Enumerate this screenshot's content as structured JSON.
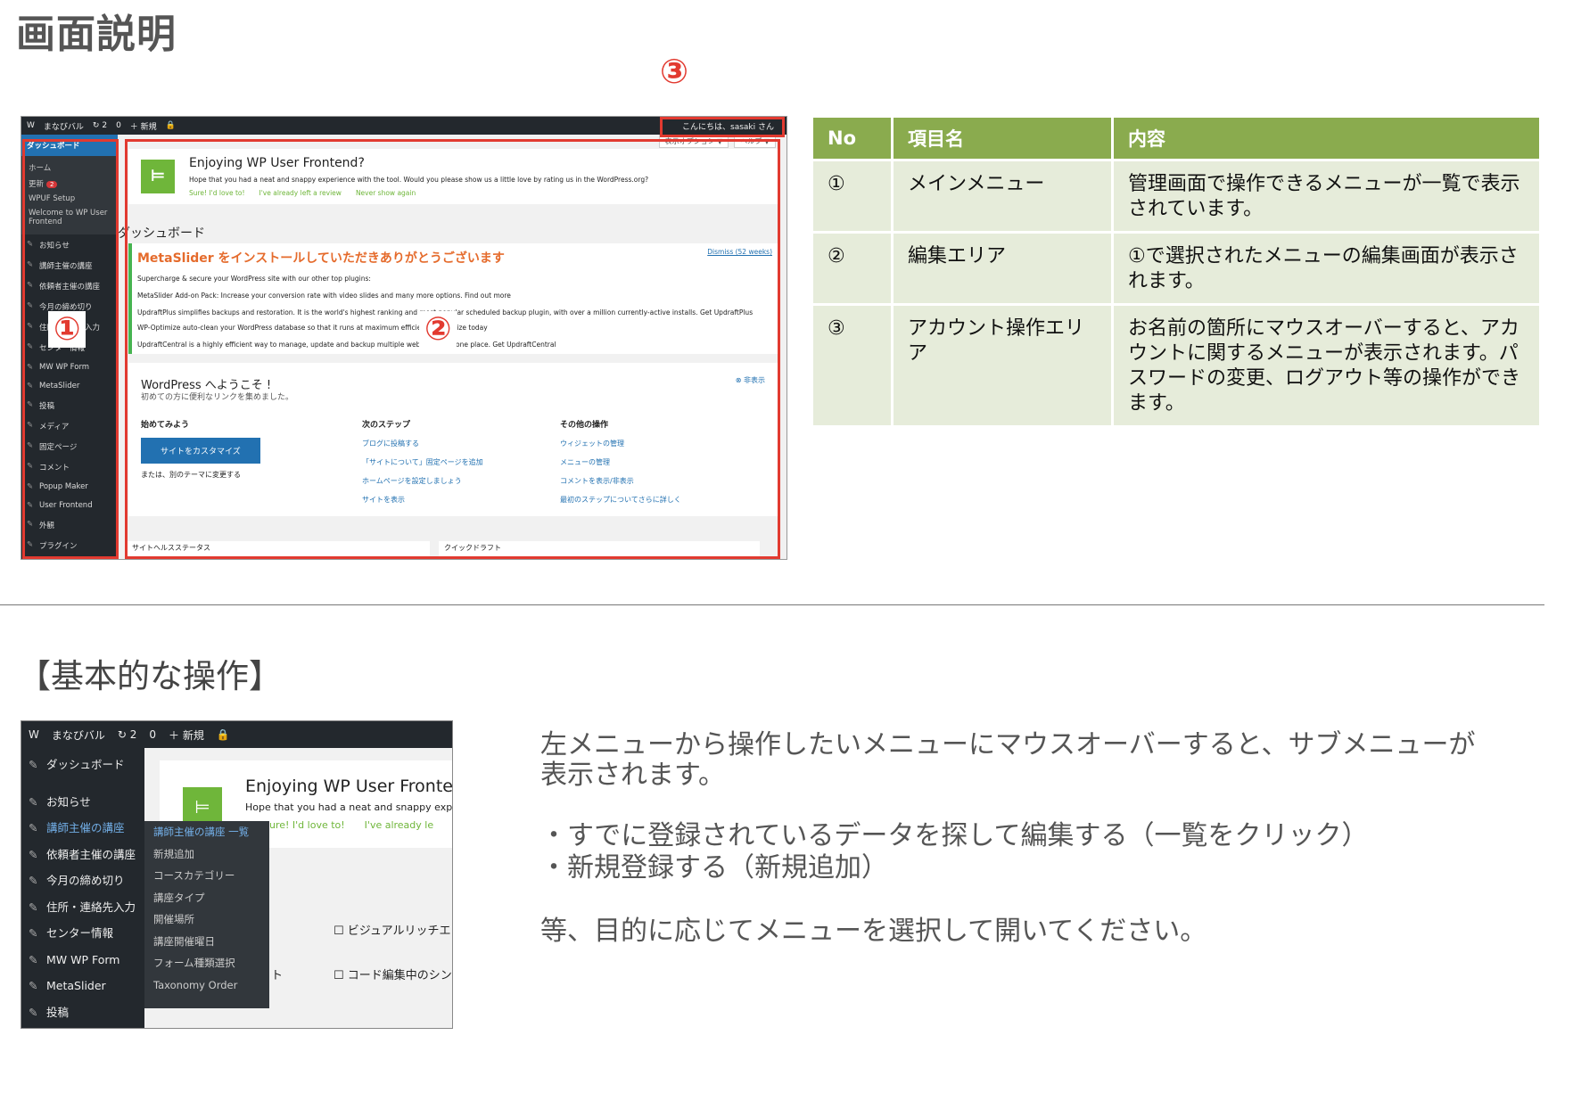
{
  "page_title": "画面説明",
  "marker3": "③",
  "shot1": {
    "topbar": [
      "W",
      "まなびバル",
      "↻ 2",
      "0",
      "＋ 新規",
      "🔒"
    ],
    "account": "こんにちは、sasaki さん",
    "side_dashboard": "ダッシュボード",
    "side_sub": [
      "ホーム",
      "更新",
      "WPUF Setup",
      "Welcome to WP User Frontend"
    ],
    "side_update_badge": "2",
    "side_items": [
      "お知らせ",
      "講師主催の講座",
      "依頼者主催の講座",
      "今月の締め切り",
      "住所・連絡先入力",
      "センター情報",
      "MW WP Form",
      "MetaSlider",
      "投稿",
      "メディア",
      "固定ページ",
      "コメント",
      "Popup Maker",
      "User Frontend",
      "外観",
      "プラグイン"
    ],
    "tabs": [
      "表示オプション ▼",
      "ヘルプ ▼"
    ],
    "wpuf_title": "Enjoying WP User Frontend?",
    "wpuf_text": "Hope that you had a neat and snappy experience with the tool. Would you please show us a little love by rating us in the WordPress.org?",
    "wpuf_links": [
      "Sure! I'd love to!",
      "I've already left a review",
      "Never show again"
    ],
    "dashboard_heading": "ダッシュボード",
    "ms_title": "MetaSlider をインストールしていただきありがとうございます",
    "ms_dismiss": "Dismiss (52 weeks)",
    "ms_lines": [
      "Supercharge & secure your WordPress site with our other top plugins:",
      "MetaSlider Add-on Pack: Increase your conversion rate with video slides and many more options. Find out more",
      "UpdraftPlus simplifies backups and restoration. It is the world's highest ranking and most popular scheduled backup plugin, with over a million currently-active installs. Get UpdraftPlus",
      "WP-Optimize auto-clean your WordPress database so that it runs at maximum efficiency. Optimize today",
      "UpdraftCentral is a highly efficient way to manage, update and backup multiple websites from one place. Get UpdraftCentral"
    ],
    "welcome_title": "WordPress へようこそ !",
    "welcome_sub": "初めての方に便利なリンクを集めました。",
    "welcome_hide": "非表示",
    "col1_title": "始めてみよう",
    "customize_btn": "サイトをカスタマイズ",
    "col1_alt": "または、別のテーマに変更する",
    "col2_title": "次のステップ",
    "col2_links": [
      "ブログに投稿する",
      "「サイトについて」固定ページを追加",
      "ホームページを設定しましょう",
      "サイトを表示"
    ],
    "col3_title": "その他の操作",
    "col3_links": [
      "ウィジェットの管理",
      "メニューの管理",
      "コメントを表示/非表示",
      "最初のステップについてさらに詳しく"
    ],
    "bottom_boxes": [
      "サイトヘルスステータス",
      "クイックドラフト"
    ],
    "marker1": "①",
    "marker2": "②"
  },
  "table": {
    "headers": [
      "No",
      "項目名",
      "内容"
    ],
    "rows": [
      {
        "no": "①",
        "name": "メインメニュー",
        "content": "管理画面で操作できるメニューが一覧で表示されています。"
      },
      {
        "no": "②",
        "name": "編集エリア",
        "content": "①で選択されたメニューの編集画面が表示されます。"
      },
      {
        "no": "③",
        "name": "アカウント操作エリア",
        "content": "お名前の箇所にマウスオーバーすると、アカウントに関するメニューが表示されます。パスワードの変更、ログアウト等の操作ができます。"
      }
    ]
  },
  "section2_title": "【基本的な操作】",
  "shot2": {
    "topbar": [
      "W",
      "まなびバル",
      "↻ 2",
      "0",
      "＋ 新規",
      "🔒"
    ],
    "side_items": [
      "ダッシュボード",
      "お知らせ",
      "講師主催の講座",
      "依頼者主催の講座",
      "今月の締め切り",
      "住所・連絡先入力",
      "センター情報",
      "MW WP Form",
      "MetaSlider",
      "投稿"
    ],
    "flyout": [
      "講師主催の講座 一覧",
      "新規追加",
      "コースカテゴリー",
      "講座タイプ",
      "開催場所",
      "講座開催曜日",
      "フォーム種類選択",
      "Taxonomy Order"
    ],
    "wpuf_title": "Enjoying WP User Fronte",
    "wpuf_text": "Hope that you had a neat and snappy exp",
    "wpuf_links": [
      "Sure! I'd love to!",
      "I've already le"
    ],
    "checkbox1": "ビジュアルリッチエ",
    "checkbox2": "コード編集中のシン",
    "fragment": "ト"
  },
  "desc": {
    "line1": "左メニューから操作したいメニューにマウスオーバーすると、サブメニューが",
    "line2": "表示されます。",
    "bullet1": "・すでに登録されているデータを探して編集する（一覧をクリック）",
    "bullet2": "・新規登録する（新規追加）",
    "closing": "等、目的に応じてメニューを選択して開いてください。"
  },
  "colors": {
    "accent_red": "#e23a30",
    "table_header": "#8aab4e",
    "table_cell": "#e6ecda",
    "wp_dark": "#23282d",
    "wp_blue": "#2271b1"
  }
}
